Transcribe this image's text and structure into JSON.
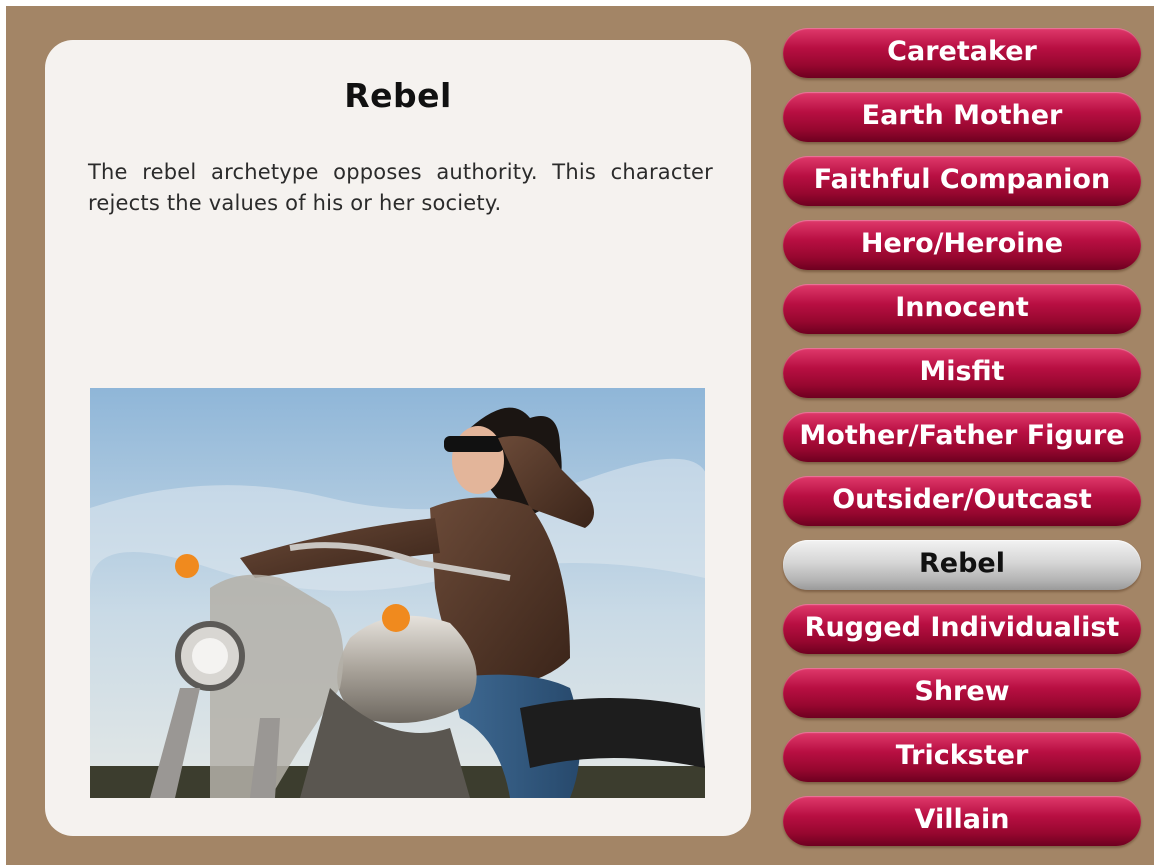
{
  "detail": {
    "title": "Rebel",
    "description": "The rebel archetype opposes authority. This character rejects the values of his or her society."
  },
  "nav": {
    "selected": "Rebel",
    "items": [
      {
        "label": "Caretaker"
      },
      {
        "label": "Earth Mother"
      },
      {
        "label": "Faithful Companion"
      },
      {
        "label": "Hero/Heroine"
      },
      {
        "label": "Innocent"
      },
      {
        "label": "Misfit"
      },
      {
        "label": "Mother/Father Figure"
      },
      {
        "label": "Outsider/Outcast"
      },
      {
        "label": "Rebel"
      },
      {
        "label": "Rugged Individualist"
      },
      {
        "label": "Shrew"
      },
      {
        "label": "Trickster"
      },
      {
        "label": "Villain"
      }
    ]
  },
  "colors": {
    "background": "#a38566",
    "card": "#f5f2ef",
    "button": "#b80f42",
    "button_selected": "#c8c8c8"
  }
}
